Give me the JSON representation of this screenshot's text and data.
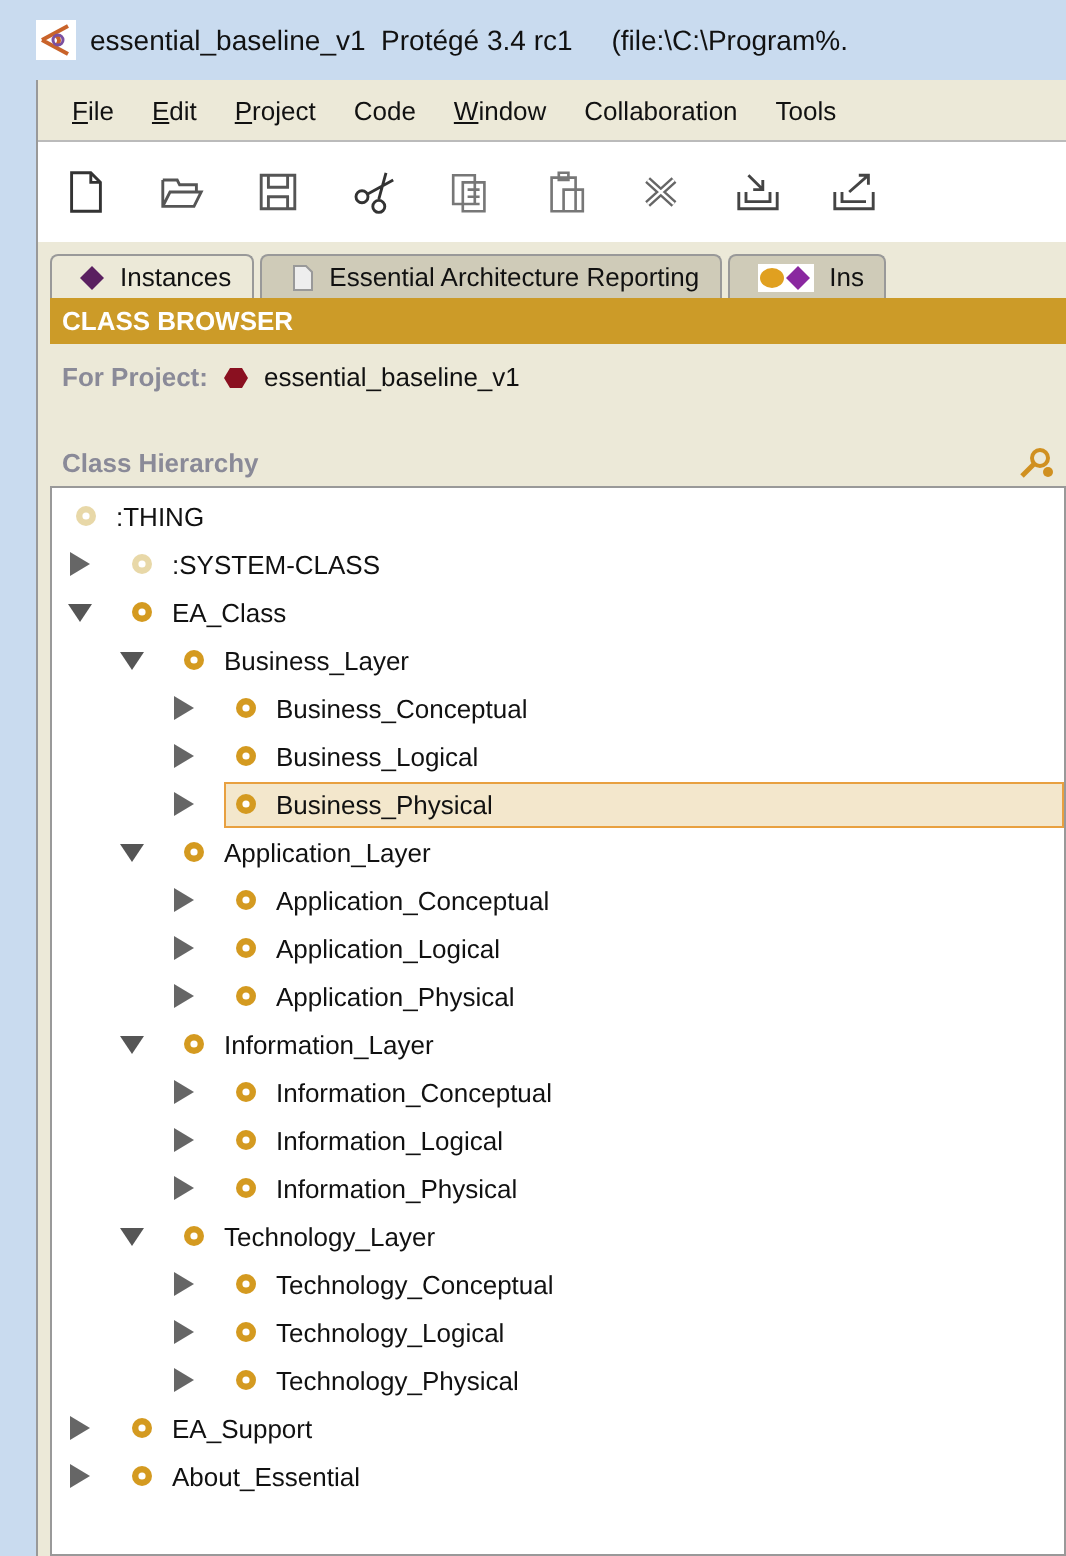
{
  "window": {
    "title": "essential_baseline_v1  Protégé 3.4 rc1     (file:\\C:\\Program%."
  },
  "menu": [
    {
      "label": "File",
      "underlined": true
    },
    {
      "label": "Edit",
      "underlined": true
    },
    {
      "label": "Project",
      "underlined": true
    },
    {
      "label": "Code",
      "underlined": false
    },
    {
      "label": "Window",
      "underlined": true
    },
    {
      "label": "Collaboration",
      "underlined": false
    },
    {
      "label": "Tools",
      "underlined": false
    }
  ],
  "toolbar": [
    {
      "kind": "new"
    },
    {
      "kind": "open"
    },
    {
      "kind": "save"
    },
    {
      "kind": "gap"
    },
    {
      "kind": "cut"
    },
    {
      "kind": "copy"
    },
    {
      "kind": "paste"
    },
    {
      "kind": "delete"
    },
    {
      "kind": "gap"
    },
    {
      "kind": "import"
    },
    {
      "kind": "export"
    }
  ],
  "tabs": [
    {
      "label": "Instances",
      "kind": "instances",
      "selected": true
    },
    {
      "label": "Essential Architecture Reporting",
      "kind": "page",
      "selected": false
    },
    {
      "label": "Ins",
      "kind": "dots",
      "selected": false
    }
  ],
  "browser": {
    "title": "CLASS BROWSER",
    "project_label": "For Project:",
    "project": "essential_baseline_v1",
    "hierarchy_label": "Class Hierarchy"
  },
  "tree": {
    "label": ":THING",
    "faded": true,
    "selected": false,
    "children": [
      {
        "label": ":SYSTEM-CLASS",
        "faded": true,
        "expanded": false,
        "selected": false
      },
      {
        "label": "EA_Class",
        "faded": false,
        "expanded": true,
        "selected": false,
        "children": [
          {
            "label": "Business_Layer",
            "faded": false,
            "expanded": true,
            "selected": false,
            "children": [
              {
                "label": "Business_Conceptual",
                "faded": false,
                "expanded": false,
                "selected": false
              },
              {
                "label": "Business_Logical",
                "faded": false,
                "expanded": false,
                "selected": false
              },
              {
                "label": "Business_Physical",
                "faded": false,
                "expanded": false,
                "selected": true
              }
            ]
          },
          {
            "label": "Application_Layer",
            "faded": false,
            "expanded": true,
            "selected": false,
            "children": [
              {
                "label": "Application_Conceptual",
                "faded": false,
                "expanded": false,
                "selected": false
              },
              {
                "label": "Application_Logical",
                "faded": false,
                "expanded": false,
                "selected": false
              },
              {
                "label": "Application_Physical",
                "faded": false,
                "expanded": false,
                "selected": false
              }
            ]
          },
          {
            "label": "Information_Layer",
            "faded": false,
            "expanded": true,
            "selected": false,
            "children": [
              {
                "label": "Information_Conceptual",
                "faded": false,
                "expanded": false,
                "selected": false
              },
              {
                "label": "Information_Logical",
                "faded": false,
                "expanded": false,
                "selected": false
              },
              {
                "label": "Information_Physical",
                "faded": false,
                "expanded": false,
                "selected": false
              }
            ]
          },
          {
            "label": "Technology_Layer",
            "faded": false,
            "expanded": true,
            "selected": false,
            "children": [
              {
                "label": "Technology_Conceptual",
                "faded": false,
                "expanded": false,
                "selected": false
              },
              {
                "label": "Technology_Logical",
                "faded": false,
                "expanded": false,
                "selected": false
              },
              {
                "label": "Technology_Physical",
                "faded": false,
                "expanded": false,
                "selected": false
              }
            ]
          }
        ]
      },
      {
        "label": "EA_Support",
        "faded": false,
        "expanded": false,
        "selected": false
      },
      {
        "label": "About_Essential",
        "faded": false,
        "expanded": false,
        "selected": false
      }
    ]
  }
}
